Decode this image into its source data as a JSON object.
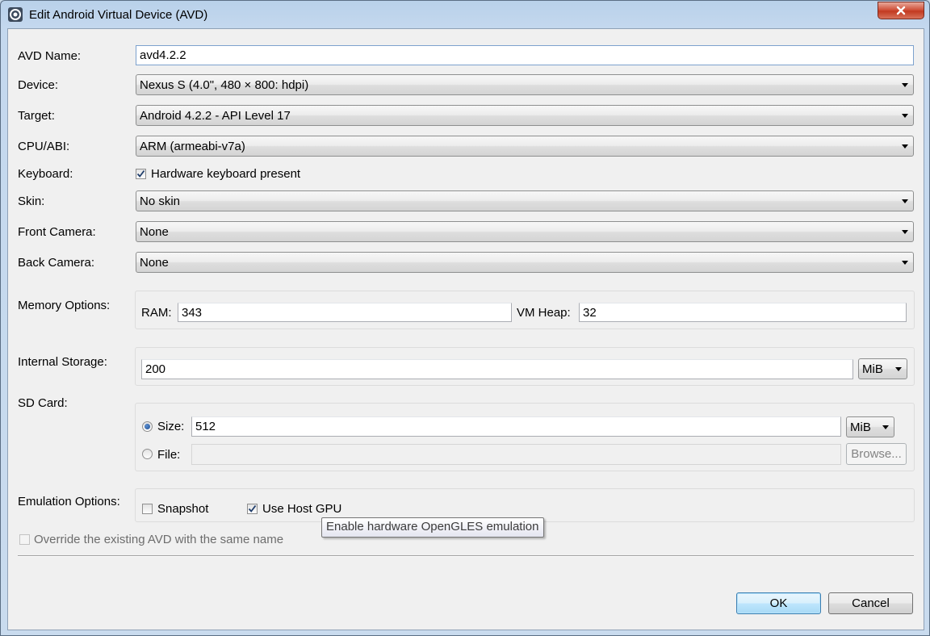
{
  "window": {
    "title": "Edit Android Virtual Device (AVD)",
    "icon": "eclipse-app-icon",
    "close_icon": "close-icon"
  },
  "form": {
    "avd_name": {
      "label": "AVD Name:",
      "value": "avd4.2.2"
    },
    "device": {
      "label": "Device:",
      "value": "Nexus S (4.0\", 480 × 800: hdpi)"
    },
    "target": {
      "label": "Target:",
      "value": "Android 4.2.2 - API Level 17"
    },
    "cpu_abi": {
      "label": "CPU/ABI:",
      "value": "ARM (armeabi-v7a)"
    },
    "keyboard": {
      "label": "Keyboard:",
      "checkbox_label": "Hardware keyboard present",
      "checked": true
    },
    "skin": {
      "label": "Skin:",
      "value": "No skin"
    },
    "front_camera": {
      "label": "Front Camera:",
      "value": "None"
    },
    "back_camera": {
      "label": "Back Camera:",
      "value": "None"
    },
    "memory": {
      "label": "Memory Options:",
      "ram_label": "RAM:",
      "ram_value": "343",
      "vm_heap_label": "VM Heap:",
      "vm_heap_value": "32"
    },
    "internal_storage": {
      "label": "Internal Storage:",
      "value": "200",
      "unit": "MiB"
    },
    "sd_card": {
      "label": "SD Card:",
      "size_label": "Size:",
      "size_value": "512",
      "size_unit": "MiB",
      "size_selected": true,
      "file_label": "File:",
      "file_value": "",
      "browse_label": "Browse..."
    },
    "emulation": {
      "label": "Emulation Options:",
      "snapshot_label": "Snapshot",
      "snapshot_checked": false,
      "host_gpu_label": "Use Host GPU",
      "host_gpu_checked": true
    },
    "override": {
      "label": "Override the existing AVD with the same name",
      "checked": false,
      "enabled": false
    }
  },
  "tooltip": {
    "text": "Enable hardware OpenGLES emulation"
  },
  "buttons": {
    "ok": "OK",
    "cancel": "Cancel"
  }
}
